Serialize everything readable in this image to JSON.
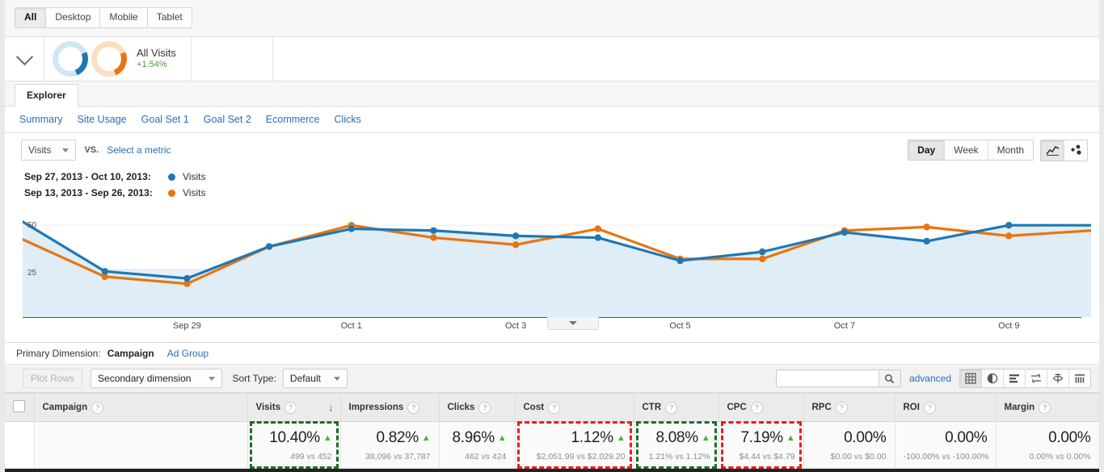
{
  "device_tabs": [
    {
      "label": "All",
      "active": true
    },
    {
      "label": "Desktop",
      "active": false
    },
    {
      "label": "Mobile",
      "active": false
    },
    {
      "label": "Tablet",
      "active": false
    }
  ],
  "segment": {
    "title": "All Visits",
    "delta": "+1.54%",
    "caret_icon": "chevron-down-icon",
    "donut_blue": "donut-chart-blue-icon",
    "donut_orange": "donut-chart-orange-icon"
  },
  "explorer_tab": "Explorer",
  "subnav": [
    "Summary",
    "Site Usage",
    "Goal Set 1",
    "Goal Set 2",
    "Ecommerce",
    "Clicks"
  ],
  "metric_toolbar": {
    "metric_selected": "Visits",
    "vs_label": "VS.",
    "select_metric": "Select a metric",
    "granularity": [
      {
        "label": "Day",
        "active": true
      },
      {
        "label": "Week",
        "active": false
      },
      {
        "label": "Month",
        "active": false
      }
    ],
    "chart_type_line": "line-chart-icon",
    "chart_type_motion": "motion-chart-icon"
  },
  "legend": [
    {
      "date_range": "Sep 27, 2013 - Oct 10, 2013:",
      "metric": "Visits",
      "color": "#1f77b4"
    },
    {
      "date_range": "Sep 13, 2013 - Sep 26, 2013:",
      "metric": "Visits",
      "color": "#e8750f"
    }
  ],
  "chart_data": {
    "type": "line",
    "title": "",
    "xlabel": "",
    "ylabel": "Visits",
    "ylim": [
      0,
      56
    ],
    "ytick_labels": [
      "50",
      "25"
    ],
    "ytick_values": [
      50,
      25
    ],
    "grid": true,
    "legend_position": "above-chart",
    "x": [
      "Sep 27",
      "Sep 28",
      "Sep 29",
      "Sep 30",
      "Oct 1",
      "Oct 2",
      "Oct 3",
      "Oct 4",
      "Oct 5",
      "Oct 6",
      "Oct 7",
      "Oct 8",
      "Oct 9",
      "Oct 10"
    ],
    "xtick_labels": [
      "Sep 29",
      "Oct 1",
      "Oct 3",
      "Oct 5",
      "Oct 7",
      "Oct 9"
    ],
    "series": [
      {
        "name": "Visits (Sep 27, 2013 - Oct 10, 2013)",
        "color": "#1f77b4",
        "values": [
          52,
          24,
          20,
          38,
          48,
          47,
          44,
          43,
          30,
          35,
          46,
          41,
          50,
          50
        ]
      },
      {
        "name": "Visits (Sep 13, 2013 - Sep 26, 2013)",
        "color": "#e8750f",
        "values": [
          42,
          21,
          17,
          38,
          50,
          43,
          39,
          48,
          31,
          31,
          47,
          49,
          44,
          47
        ]
      }
    ]
  },
  "chart_expander": "expand-chart-icon",
  "primary_dimension": {
    "label": "Primary Dimension:",
    "current": "Campaign",
    "alt": "Ad Group"
  },
  "table_toolbar": {
    "plot_rows": "Plot Rows",
    "secondary_dimension": "Secondary dimension",
    "sort_type_label": "Sort Type:",
    "sort_type_value": "Default",
    "search_value": "",
    "search_placeholder": "",
    "advanced": "advanced",
    "views": [
      {
        "icon": "table-view-icon",
        "active": true
      },
      {
        "icon": "pie-chart-view-icon",
        "active": false
      },
      {
        "icon": "bar-chart-view-icon",
        "active": false
      },
      {
        "icon": "comparison-view-icon",
        "active": false
      },
      {
        "icon": "pivot-view-icon",
        "active": false
      },
      {
        "icon": "term-cloud-view-icon",
        "active": false
      }
    ]
  },
  "table": {
    "select_all_checkbox": "select-all-checkbox",
    "columns": [
      {
        "label": "Campaign",
        "align": "left",
        "sorted": false
      },
      {
        "label": "Visits",
        "align": "left",
        "sorted": true,
        "sort_icon": "sort-descending-arrow"
      },
      {
        "label": "Impressions",
        "align": "left",
        "sorted": false
      },
      {
        "label": "Clicks",
        "align": "left",
        "sorted": false
      },
      {
        "label": "Cost",
        "align": "left",
        "sorted": false
      },
      {
        "label": "CTR",
        "align": "left",
        "sorted": false
      },
      {
        "label": "CPC",
        "align": "left",
        "sorted": false
      },
      {
        "label": "RPC",
        "align": "left",
        "sorted": false
      },
      {
        "label": "ROI",
        "align": "left",
        "sorted": false
      },
      {
        "label": "Margin",
        "align": "left",
        "sorted": false
      }
    ],
    "summary_row": [
      {
        "name": "campaign",
        "value": "",
        "sub": "",
        "arrow": false,
        "highlight": "none"
      },
      {
        "name": "visits",
        "value": "10.40%",
        "sub": "499 vs 452",
        "arrow": true,
        "highlight": "green"
      },
      {
        "name": "impressions",
        "value": "0.82%",
        "sub": "38,096 vs 37,787",
        "arrow": true,
        "highlight": "none"
      },
      {
        "name": "clicks",
        "value": "8.96%",
        "sub": "462 vs 424",
        "arrow": true,
        "highlight": "none"
      },
      {
        "name": "cost",
        "value": "1.12%",
        "sub": "$2,051.99 vs $2,029.20",
        "arrow": true,
        "highlight": "red"
      },
      {
        "name": "ctr",
        "value": "8.08%",
        "sub": "1.21% vs 1.12%",
        "arrow": true,
        "highlight": "green"
      },
      {
        "name": "cpc",
        "value": "7.19%",
        "sub": "$4.44 vs $4.79",
        "arrow": true,
        "highlight": "red"
      },
      {
        "name": "rpc",
        "value": "0.00%",
        "sub": "$0.00 vs $0.00",
        "arrow": false,
        "highlight": "none"
      },
      {
        "name": "roi",
        "value": "0.00%",
        "sub": "-100.00% vs -100.00%",
        "arrow": false,
        "highlight": "none"
      },
      {
        "name": "margin",
        "value": "0.00%",
        "sub": "0.00% vs 0.00%",
        "arrow": false,
        "highlight": "none"
      }
    ]
  },
  "colors": {
    "blue": "#1f77b4",
    "orange": "#e8750f",
    "area": "#e3f0f8",
    "link": "#2a6ebb",
    "green_up": "#4caf3f",
    "highlight_green": "#1d6b2a",
    "highlight_red": "#e81d1d"
  }
}
